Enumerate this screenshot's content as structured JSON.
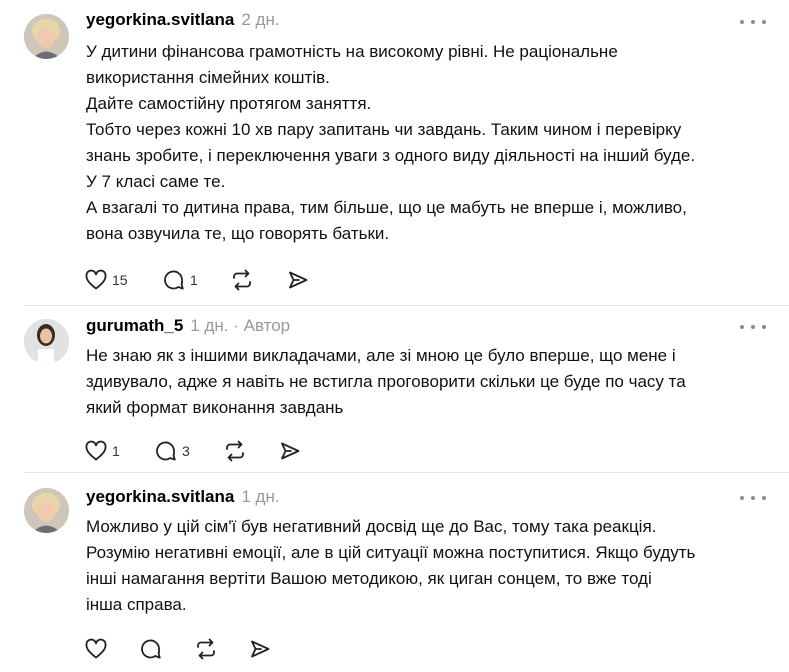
{
  "posts": [
    {
      "username": "yegorkina.svitlana",
      "time": "2 дн.",
      "role": "",
      "lines": [
        "У дитини фінансова грамотність на високому рівні. Не раціональне",
        "використання сімейних коштів.",
        "Дайте самостійну протягом заняття.",
        "Тобто через кожні 10 хв пару запитань чи завдань. Таким чином і перевірку",
        "знань зробите, і переключення уваги з одного виду діяльності на інший буде.",
        "У 7 класі саме те.",
        "А взагалі то дитина права, тим більше, що це мабуть не вперше і, можливо,",
        "вона озвучила те, що говорять батьки."
      ],
      "likes": "15",
      "replies": "1"
    },
    {
      "username": "gurumath_5",
      "time": "1 дн.",
      "role": "· Автор",
      "lines": [
        "Не знаю як з іншими викладачами, але зі мною це було вперше, що мене і",
        "здивувало, адже я навіть не встигла проговорити скільки це буде по часу та",
        "який формат виконання завдань"
      ],
      "likes": "1",
      "replies": "3"
    },
    {
      "username": "yegorkina.svitlana",
      "time": "1 дн.",
      "role": "",
      "lines": [
        "Можливо у цій сім'ї був негативний досвід ще до Вас, тому така реакція.",
        "Розумію негативні емоції, але в цій ситуації можна поступитися. Якщо будуть",
        "інші намагання вертіти Вашою методикою, як циган сонцем, то вже тоді",
        "інша справа."
      ],
      "likes": "",
      "replies": ""
    }
  ],
  "icons": {
    "like": "heart-icon",
    "reply": "comment-icon",
    "repost": "repost-icon",
    "share": "send-icon",
    "more": "more-dots-icon"
  }
}
